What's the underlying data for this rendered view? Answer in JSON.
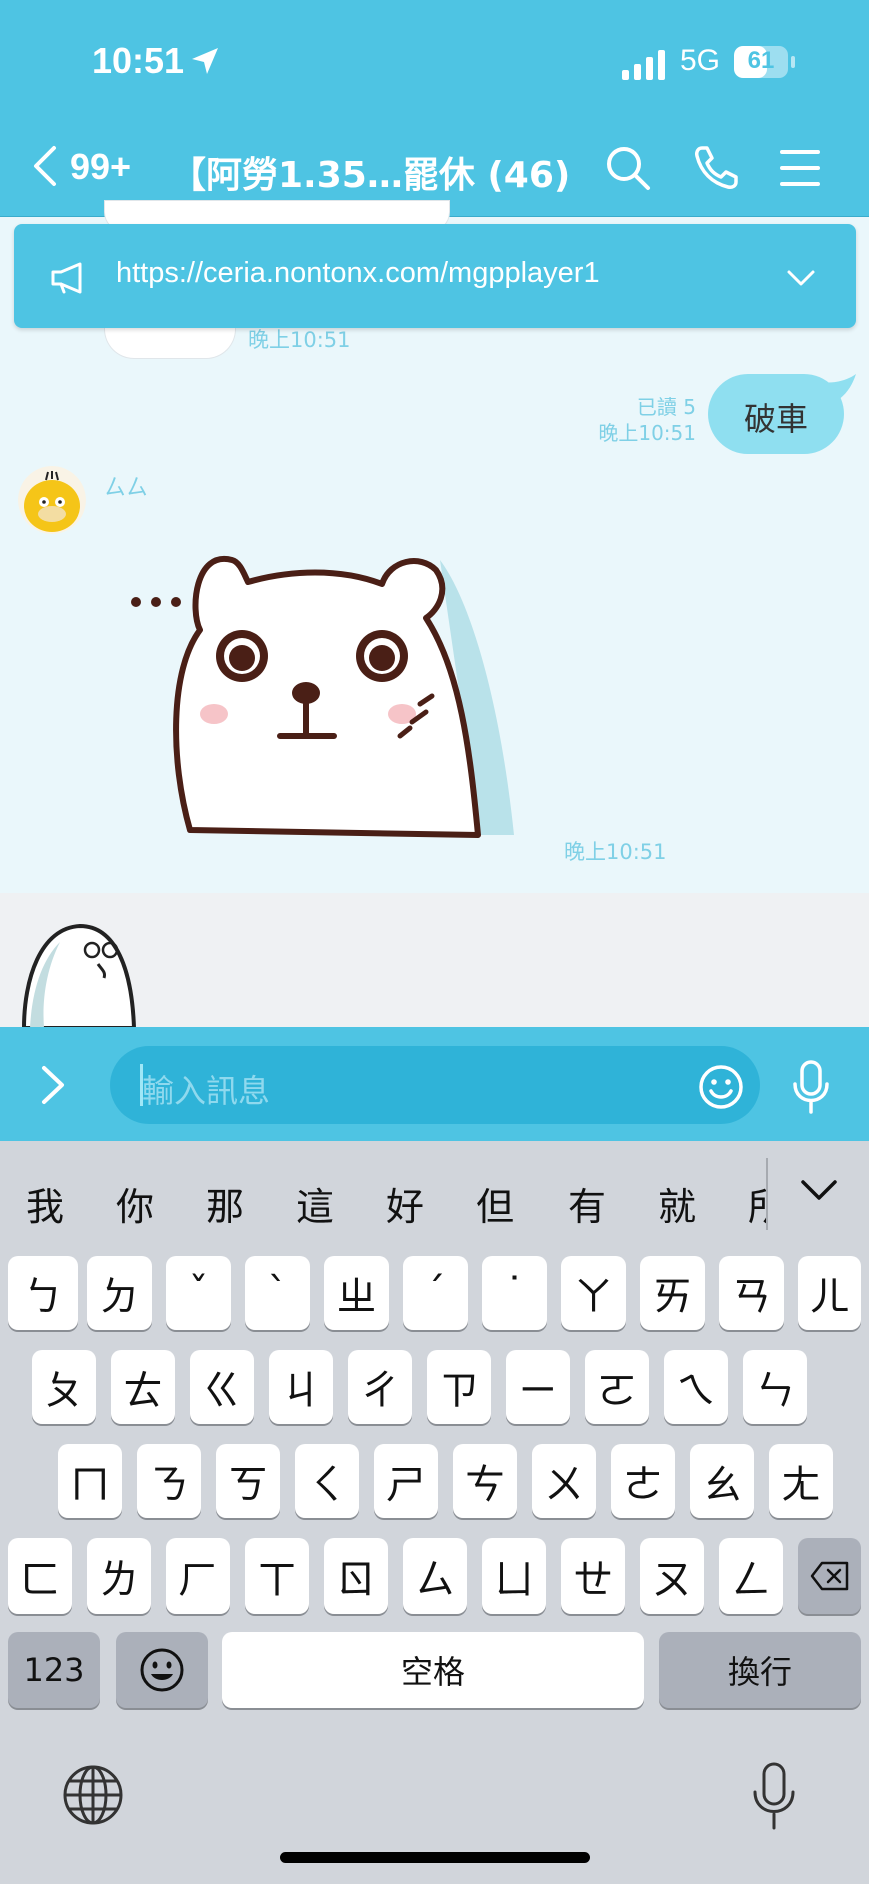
{
  "status_bar": {
    "time": "10:51",
    "network": "5G",
    "battery": "61"
  },
  "header": {
    "unread_count": "99+",
    "chat_title": "【阿勞1.35…罷休 (46)"
  },
  "announcement": {
    "url": "https://ceria.nontonx.com/mgpplayer1"
  },
  "messages": {
    "time_1": "晚上10:51",
    "read_receipt": "已讀 5",
    "my_time": "晚上10:51",
    "my_text": "破車",
    "sender_name": "ㄙㄙ",
    "sticker_time": "晚上10:51"
  },
  "input": {
    "placeholder": "輸入訊息"
  },
  "keyboard": {
    "candidates": [
      "我",
      "你",
      "那",
      "這",
      "好",
      "但",
      "有",
      "就",
      "所"
    ],
    "row1": [
      "ㄅ",
      "ㄉ",
      "ˇ",
      "ˋ",
      "ㄓ",
      "ˊ",
      "˙",
      "ㄚ",
      "ㄞ",
      "ㄢ",
      "ㄦ"
    ],
    "row2": [
      "ㄆ",
      "ㄊ",
      "ㄍ",
      "ㄐ",
      "ㄔ",
      "ㄗ",
      "ㄧ",
      "ㄛ",
      "ㄟ",
      "ㄣ"
    ],
    "row3": [
      "ㄇ",
      "ㄋ",
      "ㄎ",
      "ㄑ",
      "ㄕ",
      "ㄘ",
      "ㄨ",
      "ㄜ",
      "ㄠ",
      "ㄤ"
    ],
    "row4": [
      "ㄈ",
      "ㄌ",
      "ㄏ",
      "ㄒ",
      "ㄖ",
      "ㄙ",
      "ㄩ",
      "ㄝ",
      "ㄡ",
      "ㄥ"
    ],
    "numbers_label": "123",
    "space_label": "空格",
    "return_label": "換行"
  },
  "colors": {
    "accent": "#4ec4e3",
    "bubble": "#8fdff0",
    "meta_text": "#7fd0e6"
  }
}
